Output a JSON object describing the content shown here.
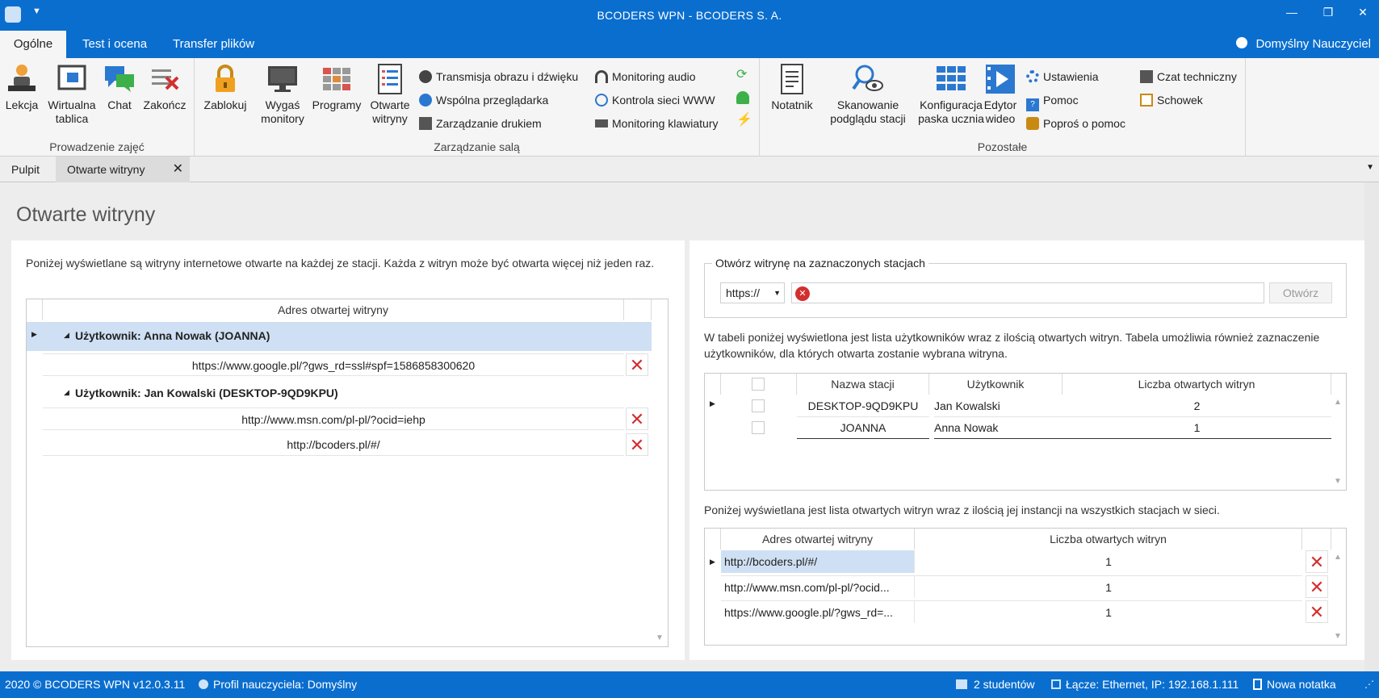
{
  "window": {
    "title": "BCODERS WPN - BCODERS S. A."
  },
  "ribbon_tabs": [
    "Ogólne",
    "Test i ocena",
    "Transfer plików"
  ],
  "user": "Domyślny Nauczyciel",
  "groups": {
    "prowadzenie": {
      "label": "Prowadzenie zajęć",
      "buttons": [
        "Lekcja",
        "Wirtualna tablica",
        "Chat",
        "Zakończ"
      ]
    },
    "sala": {
      "label": "Zarządzanie salą",
      "buttons": [
        "Zablokuj",
        "Wygaś monitory",
        "Programy",
        "Otwarte witryny"
      ],
      "small": [
        "Transmisja obrazu i dźwięku",
        "Wspólna przeglądarka",
        "Zarządzanie drukiem",
        "Monitoring audio",
        "Kontrola sieci WWW",
        "Monitoring klawiatury"
      ]
    },
    "pozostale": {
      "label": "Pozostałe",
      "buttons": [
        "Notatnik",
        "Skanowanie podglądu stacji",
        "Konfiguracja paska ucznia",
        "Edytor wideo"
      ],
      "small": [
        "Ustawienia",
        "Pomoc",
        "Poproś o pomoc",
        "Czat techniczny",
        "Schowek"
      ]
    }
  },
  "doc_tabs": [
    "Pulpit",
    "Otwarte witryny"
  ],
  "page": {
    "title": "Otwarte witryny",
    "left_desc": "Poniżej wyświetlane są witryny internetowe otwarte na każdej ze stacji. Każda z witryn może być otwarta więcej niż jeden raz.",
    "left_grid_header": "Adres otwartej witryny",
    "users": [
      {
        "label": "Użytkownik: Anna Nowak (JOANNA)",
        "urls": [
          "https://www.google.pl/?gws_rd=ssl#spf=1586858300620"
        ]
      },
      {
        "label": "Użytkownik: Jan Kowalski (DESKTOP-9QD9KPU)",
        "urls": [
          "http://www.msn.com/pl-pl/?ocid=iehp",
          "http://bcoders.pl/#/"
        ]
      }
    ],
    "open_box": {
      "legend": "Otwórz witrynę na zaznaczonych stacjach",
      "protocol": "https://",
      "button": "Otwórz"
    },
    "right_desc1": "W tabeli poniżej wyświetlona jest lista użytkowników wraz z ilością otwartych witryn. Tabela umożliwia również zaznaczenie użytkowników, dla których otwarta zostanie wybrana witryna.",
    "stations_headers": [
      "Nazwa stacji",
      "Użytkownik",
      "Liczba otwartych witryn"
    ],
    "stations": [
      {
        "station": "DESKTOP-9QD9KPU",
        "user": "Jan Kowalski",
        "count": "2"
      },
      {
        "station": "JOANNA",
        "user": "Anna Nowak",
        "count": "1"
      }
    ],
    "right_desc2": "Poniżej wyświetlana jest lista otwartych witryn wraz z ilością jej instancji na wszystkich stacjach w sieci.",
    "sites_headers": [
      "Adres otwartej witryny",
      "Liczba otwartych witryn"
    ],
    "sites": [
      {
        "url": "http://bcoders.pl/#/",
        "count": "1"
      },
      {
        "url": "http://www.msn.com/pl-pl/?ocid...",
        "count": "1"
      },
      {
        "url": "https://www.google.pl/?gws_rd=...",
        "count": "1"
      }
    ]
  },
  "status": {
    "copyright": "2020 ©  BCODERS WPN v12.0.3.11",
    "profile": "Profil nauczyciela: Domyślny",
    "students": "2 studentów",
    "connection": "Łącze: Ethernet, IP: 192.168.1.111",
    "note": "Nowa notatka"
  },
  "colors": {
    "accent": "#0a6ecf",
    "selected_row": "#cfe0f4",
    "delete": "#d32f2f"
  }
}
